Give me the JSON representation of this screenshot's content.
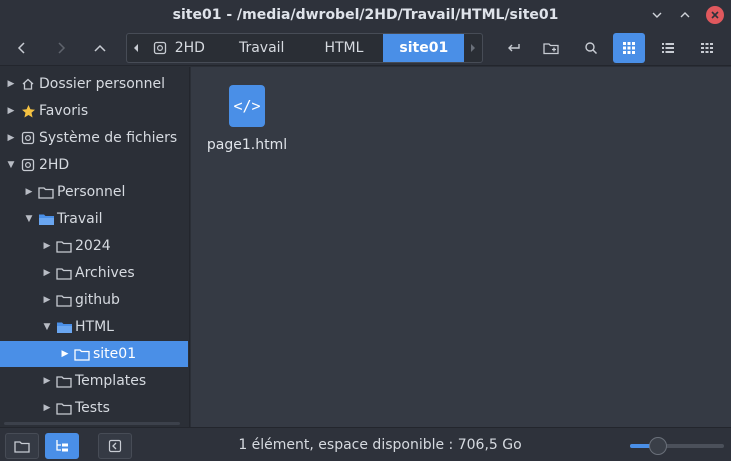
{
  "window": {
    "title": "site01 - /media/dwrobel/2HD/Travail/HTML/site01"
  },
  "pathbar": {
    "crumbs": [
      "2HD",
      "Travail",
      "HTML",
      "site01"
    ],
    "active_index": 3
  },
  "sidebar": {
    "items": [
      {
        "label": "Dossier personnel",
        "icon": "home-icon",
        "expander": "collapsed"
      },
      {
        "label": "Favoris",
        "icon": "star-icon",
        "expander": "collapsed"
      },
      {
        "label": "Système de fichiers",
        "icon": "drive-icon",
        "expander": "collapsed"
      },
      {
        "label": "2HD",
        "icon": "drive-icon",
        "expander": "expanded"
      },
      {
        "label": "Personnel",
        "icon": "folder-icon",
        "expander": "collapsed"
      },
      {
        "label": "Travail",
        "icon": "folder-open-icon",
        "expander": "expanded"
      },
      {
        "label": "2024",
        "icon": "folder-icon",
        "expander": "collapsed"
      },
      {
        "label": "Archives",
        "icon": "folder-icon",
        "expander": "collapsed"
      },
      {
        "label": "github",
        "icon": "folder-icon",
        "expander": "collapsed"
      },
      {
        "label": "HTML",
        "icon": "folder-open-icon",
        "expander": "expanded"
      },
      {
        "label": "site01",
        "icon": "folder-icon",
        "expander": "collapsed",
        "selected": true
      },
      {
        "label": "Templates",
        "icon": "folder-icon",
        "expander": "collapsed"
      },
      {
        "label": "Tests",
        "icon": "folder-icon",
        "expander": "collapsed"
      }
    ]
  },
  "main": {
    "files": [
      {
        "name": "page1.html",
        "icon": "html-file-icon",
        "glyph": "</>"
      }
    ]
  },
  "statusbar": {
    "text": "1 élément, espace disponible : 706,5 Go",
    "zoom_level": 0.3
  },
  "colors": {
    "accent": "#4a8fe7",
    "close_button": "#e0585d",
    "background": "#2b2f37",
    "content": "#353a44"
  }
}
